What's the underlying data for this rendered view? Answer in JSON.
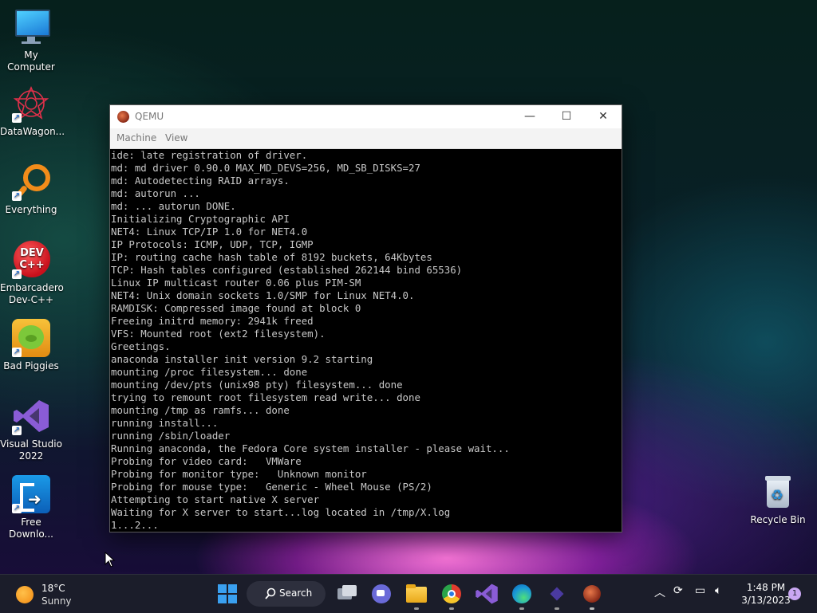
{
  "desktop": {
    "icons": [
      {
        "label": "My Computer",
        "icon": "monitor-icon"
      },
      {
        "label": "DataWagon...",
        "icon": "datawagon-icon"
      },
      {
        "label": "Everything",
        "icon": "search-magnifier-icon"
      },
      {
        "label": "Embarcadero Dev-C++",
        "icon": "devcpp-icon",
        "badge": "DEV C++"
      },
      {
        "label": "Bad Piggies",
        "icon": "bad-piggies-icon"
      },
      {
        "label": "Visual Studio 2022",
        "icon": "visual-studio-icon"
      },
      {
        "label": "Free Downlo...",
        "icon": "free-download-icon"
      }
    ],
    "recycle_bin": {
      "label": "Recycle Bin",
      "icon": "recycle-bin-icon"
    }
  },
  "window": {
    "title": "QEMU",
    "menu": [
      "Machine",
      "View"
    ],
    "console_lines": [
      "ide: late registration of driver.",
      "md: md driver 0.90.0 MAX_MD_DEVS=256, MD_SB_DISKS=27",
      "md: Autodetecting RAID arrays.",
      "md: autorun ...",
      "md: ... autorun DONE.",
      "Initializing Cryptographic API",
      "NET4: Linux TCP/IP 1.0 for NET4.0",
      "IP Protocols: ICMP, UDP, TCP, IGMP",
      "IP: routing cache hash table of 8192 buckets, 64Kbytes",
      "TCP: Hash tables configured (established 262144 bind 65536)",
      "Linux IP multicast router 0.06 plus PIM-SM",
      "NET4: Unix domain sockets 1.0/SMP for Linux NET4.0.",
      "RAMDISK: Compressed image found at block 0",
      "Freeing initrd memory: 2941k freed",
      "VFS: Mounted root (ext2 filesystem).",
      "Greetings.",
      "anaconda installer init version 9.2 starting",
      "mounting /proc filesystem... done",
      "mounting /dev/pts (unix98 pty) filesystem... done",
      "trying to remount root filesystem read write... done",
      "mounting /tmp as ramfs... done",
      "running install...",
      "running /sbin/loader",
      "Running anaconda, the Fedora Core system installer - please wait...",
      "Probing for video card:   VMWare",
      "Probing for monitor type:   Unknown monitor",
      "Probing for mouse type:   Generic - Wheel Mouse (PS/2)",
      "Attempting to start native X server",
      "Waiting for X server to start...log located in /tmp/X.log",
      "1...2...",
      "",
      ""
    ]
  },
  "taskbar": {
    "weather": {
      "temp": "18°C",
      "condition": "Sunny"
    },
    "search_label": "Search",
    "apps": [
      "start-icon",
      "task-view-icon",
      "teams-chat-icon",
      "file-explorer-icon",
      "chrome-icon",
      "visual-studio-icon",
      "edge-icon",
      "app-icon",
      "qemu-icon"
    ],
    "clock": {
      "time": "1:48 PM",
      "date": "3/13/2023"
    },
    "notification_count": "1"
  },
  "colors": {
    "taskbar": "#1b1d2a",
    "console_text": "#c8c8c8",
    "console_bg": "#000000"
  }
}
